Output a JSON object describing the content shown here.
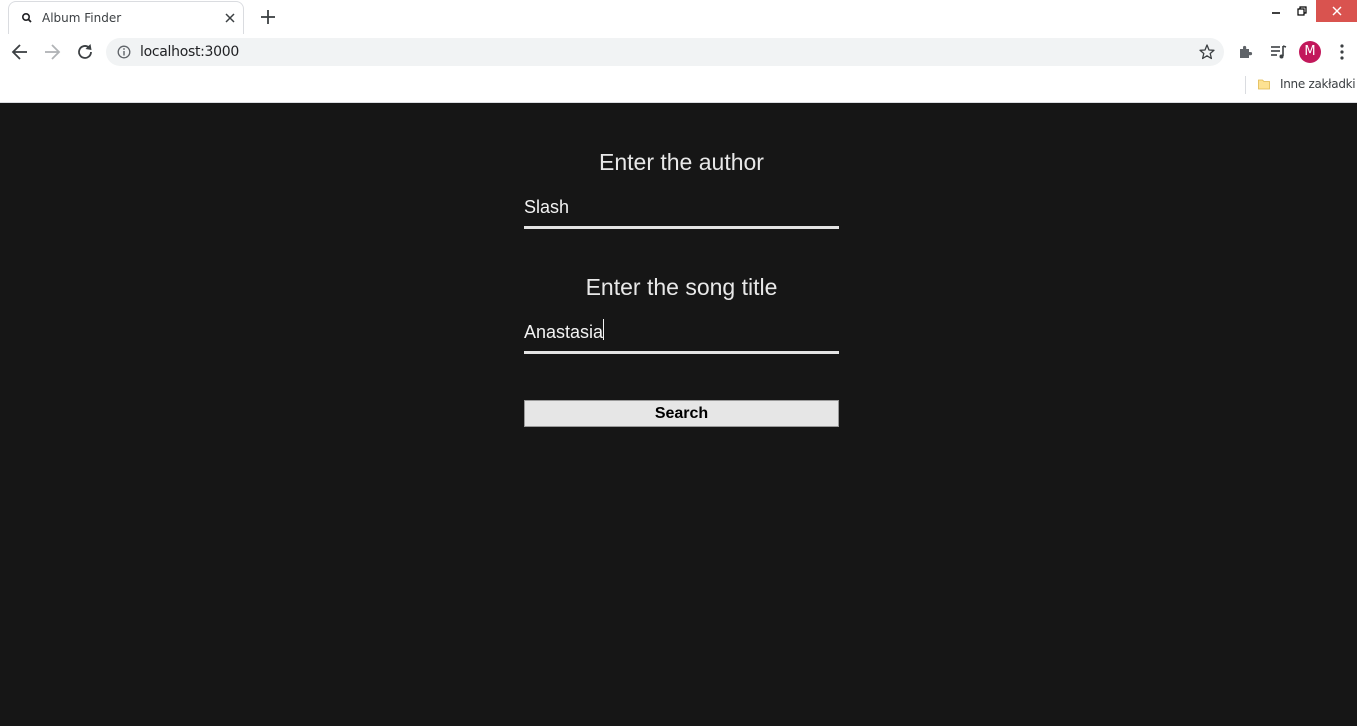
{
  "browser": {
    "tab_title": "Album Finder",
    "url": "localhost:3000",
    "profile_initial": "M",
    "bookmarks": [
      {
        "label": "Inne zakładki"
      }
    ],
    "icons": [
      "search-icon",
      "close-icon",
      "plus-icon",
      "minimize-icon",
      "restore-icon",
      "close-window-icon",
      "back-arrow-icon",
      "forward-arrow-icon",
      "reload-icon",
      "info-icon",
      "star-icon",
      "puzzle-icon",
      "media-queue-icon",
      "kebab-menu-icon",
      "folder-icon"
    ],
    "colors": {
      "close_button": "#d9534f",
      "avatar": "#c2185b"
    }
  },
  "form": {
    "author_label": "Enter the author",
    "author_value": "Slash",
    "song_label": "Enter the song title",
    "song_value": "Anastasia",
    "search_label": "Search"
  },
  "colors": {
    "page_background": "#161616",
    "text": "#e8e8e8",
    "button_background": "#e6e6e6"
  }
}
